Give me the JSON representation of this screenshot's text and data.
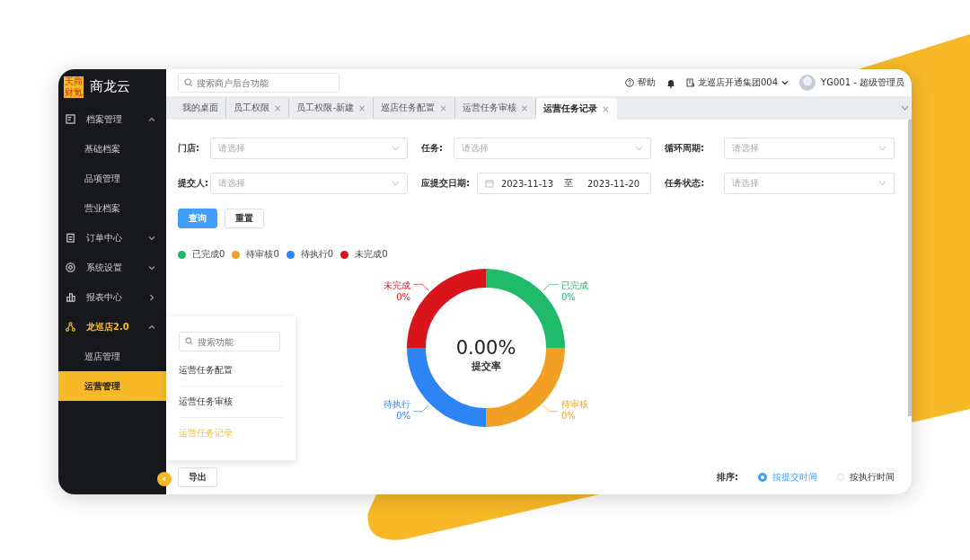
{
  "sidebar": {
    "logo_mark": "天商财氪",
    "title": "商龙云",
    "items": [
      {
        "label": "档案管理",
        "expanded": true,
        "selected": false,
        "children": [
          {
            "label": "基础档案",
            "selected": false
          },
          {
            "label": "品项管理",
            "selected": false
          },
          {
            "label": "营业档案",
            "selected": false
          }
        ]
      },
      {
        "label": "订单中心",
        "expanded": false,
        "selected": false
      },
      {
        "label": "系统设置",
        "expanded": false,
        "selected": false
      },
      {
        "label": "报表中心",
        "selected": false
      },
      {
        "label": "龙巡店2.0",
        "expanded": true,
        "selected": true,
        "children": [
          {
            "label": "巡店管理",
            "selected": false
          },
          {
            "label": "运营管理",
            "selected": true
          }
        ]
      }
    ]
  },
  "topbar": {
    "search": {
      "placeholder": "搜索商户后台功能"
    },
    "help": "帮助",
    "org": "龙巡店开通集团004",
    "user": "YG001 - 超级管理员"
  },
  "tabs": [
    {
      "label": "我的桌面",
      "selected": false
    },
    {
      "label": "员工权限",
      "close": "×",
      "selected": false
    },
    {
      "label": "员工权限-新建",
      "close": "×",
      "selected": false
    },
    {
      "label": "巡店任务配置",
      "close": "×",
      "selected": false
    },
    {
      "label": "运营任务审核",
      "close": "×",
      "selected": false
    },
    {
      "label": "运营任务记录",
      "close": "×",
      "selected": true
    }
  ],
  "filters": [
    [
      {
        "kind": "select",
        "label": "门店:",
        "placeholder": "请选择"
      },
      {
        "kind": "select",
        "label": "任务:",
        "placeholder": "请选择"
      },
      {
        "kind": "select",
        "label": "循环周期:",
        "placeholder": "请选择"
      }
    ],
    [
      {
        "kind": "select",
        "label": "提交人:",
        "placeholder": "请选择"
      },
      {
        "kind": "daterange",
        "label": "应提交日期:",
        "start": "2023-11-13",
        "separator": "至",
        "end": "2023-11-20"
      },
      {
        "kind": "select",
        "label": "任务状态:",
        "placeholder": "请选择"
      }
    ]
  ],
  "buttons": [
    {
      "label": "查询",
      "kind": "primary"
    },
    {
      "label": "重置",
      "kind": "plain"
    }
  ],
  "legend": [
    {
      "label": "已完成0",
      "color": "#1fba6a"
    },
    {
      "label": "待审核0",
      "color": "#f2a024"
    },
    {
      "label": "待执行0",
      "color": "#2d84f5"
    },
    {
      "label": "未完成0",
      "color": "#d9141a"
    }
  ],
  "donut": {
    "center_value": "0.00%",
    "center_label": "提交率",
    "segments": [
      {
        "label": "未完成",
        "percent": "0%",
        "color": "#d9141a"
      },
      {
        "label": "已完成",
        "percent": "0%",
        "color": "#1fba6a"
      },
      {
        "label": "待执行",
        "percent": "0%",
        "color": "#2d84f5"
      },
      {
        "label": "待审核",
        "percent": "0%",
        "color": "#f2a024"
      }
    ]
  },
  "popover": {
    "search": {
      "placeholder": "搜索功能"
    },
    "items": [
      {
        "label": "运营任务配置",
        "selected": false
      },
      {
        "label": "运营任务审核",
        "selected": false
      },
      {
        "label": "运营任务记录",
        "selected": true
      }
    ]
  },
  "footer": {
    "export": "导出",
    "sort_label": "排序:",
    "options": [
      {
        "label": "按提交时间",
        "selected": true
      },
      {
        "label": "按执行时间",
        "selected": false
      }
    ]
  }
}
